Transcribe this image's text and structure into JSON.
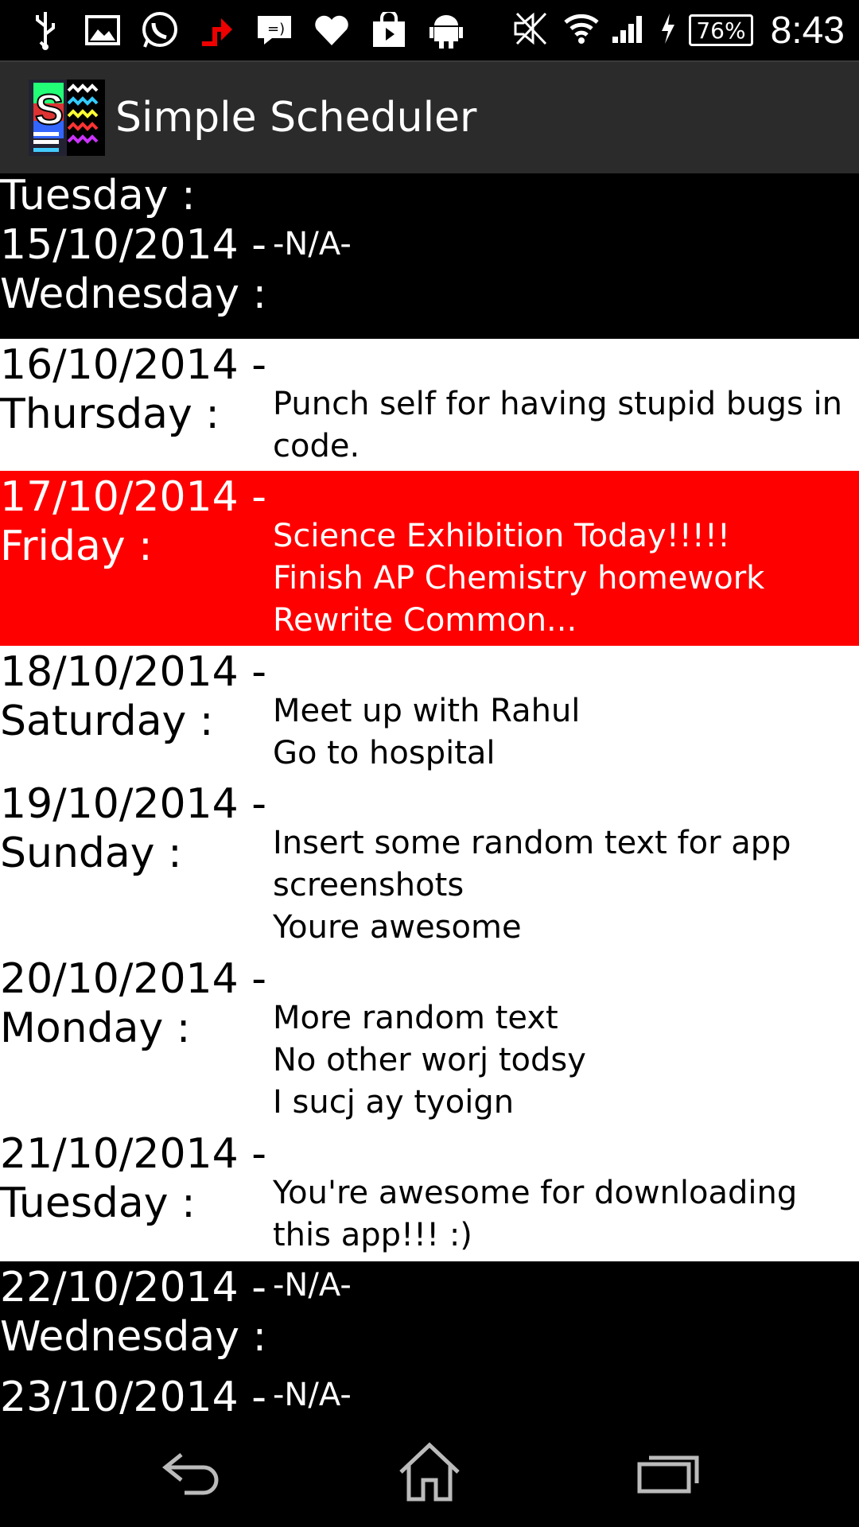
{
  "status_bar": {
    "icons": [
      "usb-icon",
      "image-icon",
      "whatsapp-icon",
      "upload-icon",
      "message-icon",
      "heart-icon",
      "store-icon",
      "android-icon",
      "mute-icon",
      "wifi-icon",
      "signal-icon",
      "charging-icon"
    ],
    "battery": "76%",
    "time": "8:43"
  },
  "app": {
    "title": "Simple Scheduler"
  },
  "colors": {
    "today_highlight": "#ff0000",
    "empty_row": "#000000",
    "filled_row": "#ffffff",
    "action_bar": "#2b2b2b"
  },
  "schedule": [
    {
      "date": "Tuesday :",
      "tasks": []
    },
    {
      "date": "15/10/2014 -\nWednesday :",
      "tasks": [
        "-N/A-"
      ]
    },
    {
      "date": "16/10/2014 -\nThursday :",
      "tasks": [
        "Punch self for having stupid bugs in code."
      ]
    },
    {
      "date": "17/10/2014 -\nFriday :",
      "tasks": [
        "Science Exhibition Today!!!!!",
        "Finish AP Chemistry homework",
        "Rewrite Common..."
      ]
    },
    {
      "date": "18/10/2014 -\nSaturday :",
      "tasks": [
        "Meet up with Rahul",
        "Go to hospital"
      ]
    },
    {
      "date": "19/10/2014 -\nSunday :",
      "tasks": [
        "Insert some random text for app screenshots",
        "Youre awesome"
      ]
    },
    {
      "date": "20/10/2014 -\nMonday :",
      "tasks": [
        "More random text",
        "No other worj todsy",
        "I sucj ay tyoign"
      ]
    },
    {
      "date": "21/10/2014 -\nTuesday :",
      "tasks": [
        "You're awesome for downloading this app!!! :)"
      ]
    },
    {
      "date": "22/10/2014 -\nWednesday :",
      "tasks": [
        "-N/A-"
      ]
    },
    {
      "date": "23/10/2014 -",
      "tasks": [
        "-N/A-"
      ]
    }
  ],
  "nav_bar": {
    "icons": [
      "back-icon",
      "home-icon",
      "recents-icon"
    ]
  }
}
